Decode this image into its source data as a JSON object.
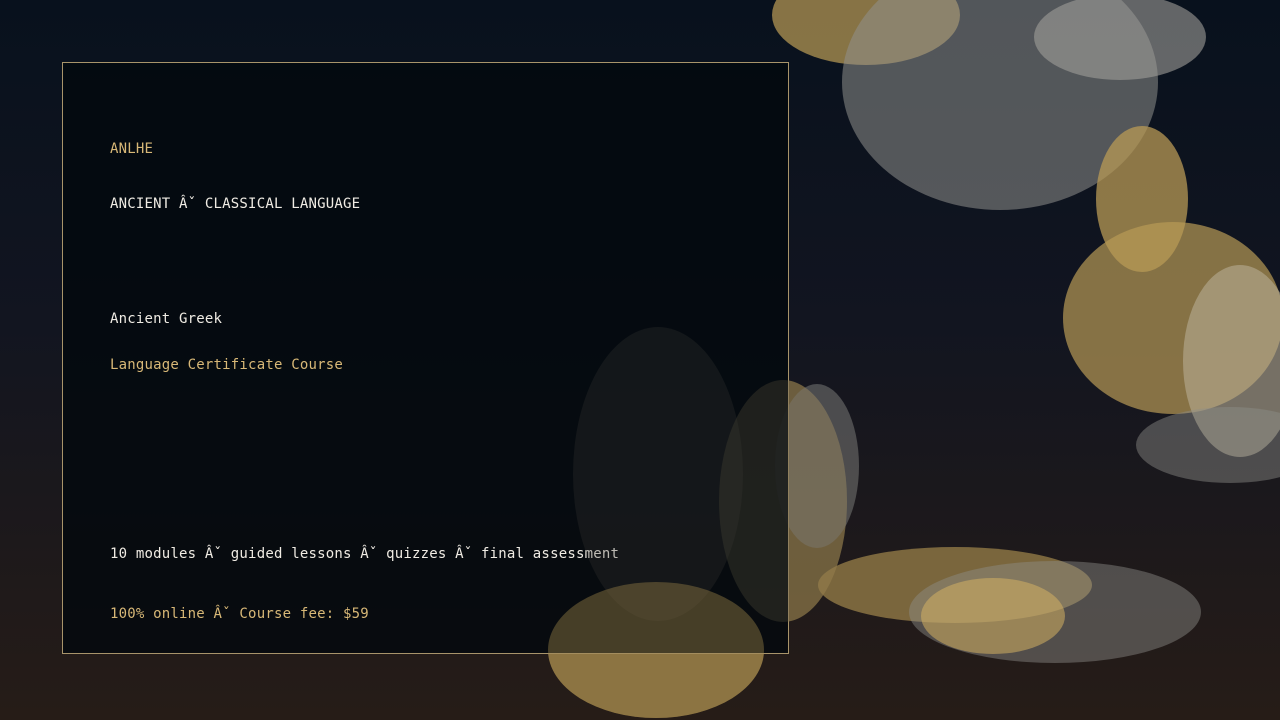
{
  "brand": "ANLHE",
  "category": "ANCIENT Âˇ CLASSICAL LANGUAGE",
  "course_title": "Ancient Greek",
  "course_subtitle": "Language Certificate Course",
  "details": "10 modules Âˇ guided lessons Âˇ quizzes Âˇ final assessment",
  "pricing": "100% online Âˇ Course fee: $59",
  "colors": {
    "accent": "#d8b877",
    "text": "#f0ece4",
    "border": "#a8946a",
    "bokeh_gold": "#c8a95e",
    "bokeh_gray": "#8e8e8a"
  }
}
